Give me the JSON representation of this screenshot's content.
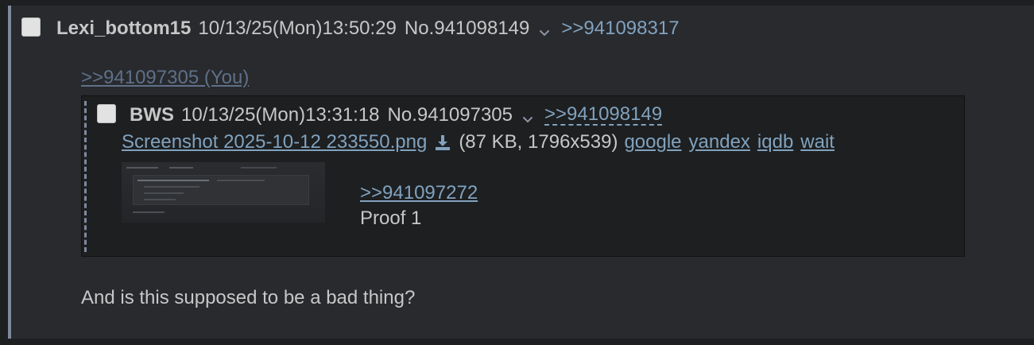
{
  "post": {
    "name": "Lexi_bottom15",
    "datetime": "10/13/25(Mon)13:50:29",
    "number": "No.941098149",
    "backlink": ">>941098317",
    "quote_you": ">>941097305 (You)",
    "comment": "And is this supposed to be a bad thing?"
  },
  "inline_post": {
    "name": "BWS",
    "datetime": "10/13/25(Mon)13:31:18",
    "number": "No.941097305",
    "backlink": ">>941098149",
    "file": {
      "filename": "Screenshot 2025-10-12 233550.png",
      "info": "(87 KB, 1796x539)",
      "search_links": [
        "google",
        "yandex",
        "iqdb",
        "wait"
      ]
    },
    "quote": ">>941097272",
    "text": "Proof 1"
  },
  "colors": {
    "background": "#1d1f21",
    "post_background": "#282a2e",
    "link": "#81a2be",
    "text": "#c5c8c6",
    "quote_you": "#5f7088"
  },
  "icons": {
    "checkbox": "checkbox-icon",
    "chevron": "chevron-down-icon",
    "download": "download-icon"
  }
}
